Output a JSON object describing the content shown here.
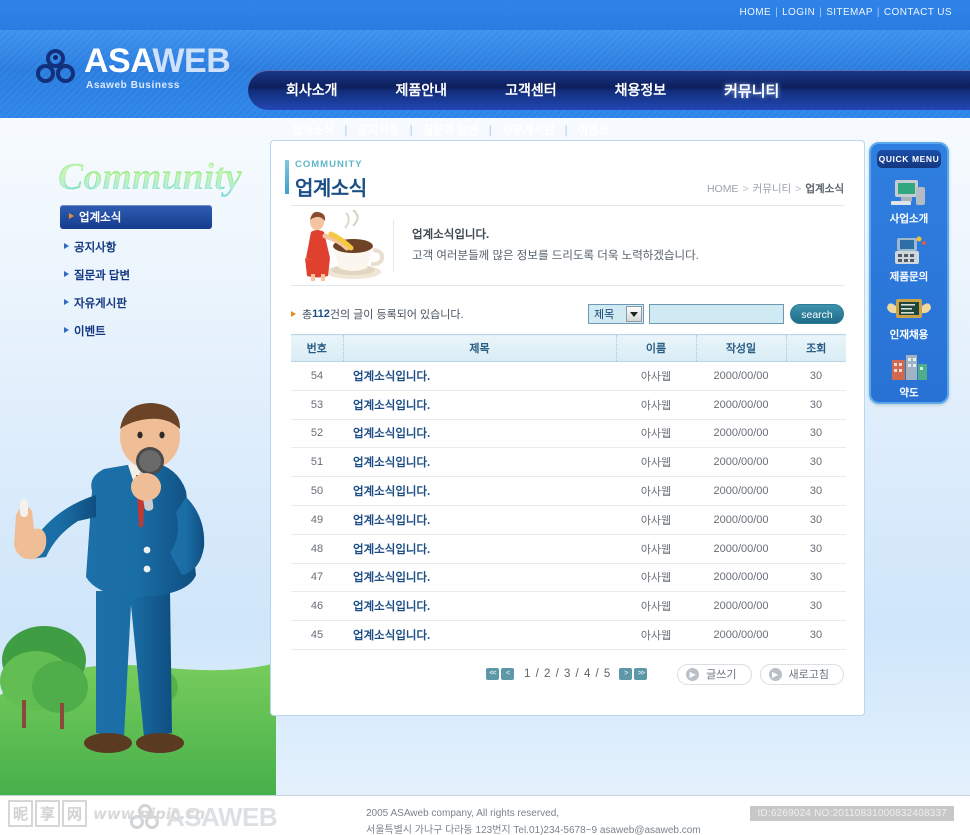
{
  "topbar": {
    "links": [
      "HOME",
      "LOGIN",
      "SITEMAP",
      "CONTACT US"
    ],
    "separator": "|"
  },
  "logo": {
    "word_primary": "ASA",
    "word_secondary": "WEB",
    "tagline": "Asaweb Business"
  },
  "mainnav": {
    "items": [
      {
        "label": "회사소개",
        "active": false
      },
      {
        "label": "제품안내",
        "active": false
      },
      {
        "label": "고객센터",
        "active": false
      },
      {
        "label": "채용정보",
        "active": false
      },
      {
        "label": "커뮤니티",
        "active": true
      }
    ]
  },
  "subnav": {
    "items": [
      "업계소식",
      "공지사항",
      "질문과 답변",
      "자유게시판",
      "이벤트"
    ],
    "separator": "|"
  },
  "sidebar": {
    "title": "Community",
    "items": [
      {
        "label": "업계소식",
        "active": true
      },
      {
        "label": "공지사항",
        "active": false
      },
      {
        "label": "질문과 답변",
        "active": false
      },
      {
        "label": "자유게시판",
        "active": false
      },
      {
        "label": "이벤트",
        "active": false
      }
    ]
  },
  "panel": {
    "eyebrow": "COMMUNITY",
    "title": "업계소식",
    "breadcrumb": {
      "home": "HOME",
      "gt": ">",
      "section": "커뮤니티",
      "page": "업계소식"
    },
    "intro": {
      "line1": "업계소식입니다.",
      "line2": "고객 여러분들께 많은 정보를 드리도록 더욱 노력하겠습니다."
    }
  },
  "search": {
    "count_prefix": "총 ",
    "count_value": "112",
    "count_suffix": "건의 글이 등록되어 있습니다.",
    "select_value": "제목",
    "input_value": "",
    "button_label": "search"
  },
  "table": {
    "headers": [
      "번호",
      "제목",
      "이름",
      "작성일",
      "조회"
    ],
    "rows": [
      {
        "no": "54",
        "subject": "업계소식입니다.",
        "name": "아사웹",
        "date": "2000/00/00",
        "hits": "30"
      },
      {
        "no": "53",
        "subject": "업계소식입니다.",
        "name": "아사웹",
        "date": "2000/00/00",
        "hits": "30"
      },
      {
        "no": "52",
        "subject": "업계소식입니다.",
        "name": "아사웹",
        "date": "2000/00/00",
        "hits": "30"
      },
      {
        "no": "51",
        "subject": "업계소식입니다.",
        "name": "아사웹",
        "date": "2000/00/00",
        "hits": "30"
      },
      {
        "no": "50",
        "subject": "업계소식입니다.",
        "name": "아사웹",
        "date": "2000/00/00",
        "hits": "30"
      },
      {
        "no": "49",
        "subject": "업계소식입니다.",
        "name": "아사웹",
        "date": "2000/00/00",
        "hits": "30"
      },
      {
        "no": "48",
        "subject": "업계소식입니다.",
        "name": "아사웹",
        "date": "2000/00/00",
        "hits": "30"
      },
      {
        "no": "47",
        "subject": "업계소식입니다.",
        "name": "아사웹",
        "date": "2000/00/00",
        "hits": "30"
      },
      {
        "no": "46",
        "subject": "업계소식입니다.",
        "name": "아사웹",
        "date": "2000/00/00",
        "hits": "30"
      },
      {
        "no": "45",
        "subject": "업계소식입니다.",
        "name": "아사웹",
        "date": "2000/00/00",
        "hits": "30"
      }
    ]
  },
  "pager": {
    "first_label": "<<",
    "prev_label": "<",
    "pages": "1 / 2 / 3 / 4 / 5",
    "next_label": ">",
    "last_label": ">>",
    "write_label": "글쓰기",
    "refresh_label": "새로고침",
    "action_icon": "▶"
  },
  "quickmenu": {
    "title": "QUICK MENU",
    "items": [
      {
        "label": "사업소개",
        "icon": "computer-icon"
      },
      {
        "label": "제품문의",
        "icon": "mobile-phone-icon"
      },
      {
        "label": "인재채용",
        "icon": "blackboard-wings-icon"
      },
      {
        "label": "약도",
        "icon": "buildings-map-icon"
      }
    ]
  },
  "footer": {
    "logo_text": "ASAWEB",
    "copyright": "2005 ASAweb company, All rights reserved,",
    "address": "서울특별시 가나구 다라동 123번지 Tel.01)234-5678~9 asaweb@asaweb.com",
    "watermark_id": "ID:6269024 NO:20110831000832408337",
    "watermark_brand": "昵享网",
    "watermark_url": "www.nipic.cn"
  },
  "colors": {
    "brand_blue": "#2a7ddf",
    "nav_dark": "#0d1f5c",
    "accent_orange": "#f0882a",
    "title_blue": "#1b4f86",
    "search_field": "#cfeaf2"
  }
}
